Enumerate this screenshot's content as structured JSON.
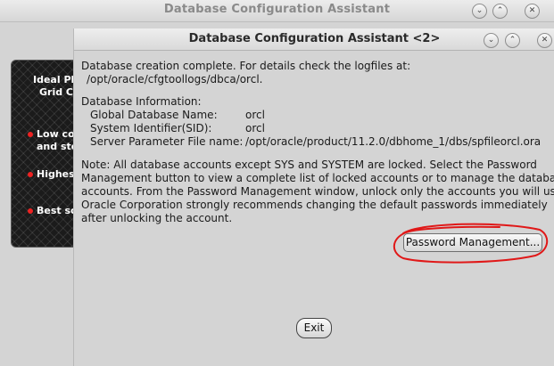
{
  "background_window": {
    "title": "Database Configuration Assistant",
    "panel_lines": [
      "Ideal Pl",
      "Grid C",
      "Low co",
      "and sto",
      "Highes",
      "Best sc"
    ]
  },
  "dialog": {
    "title": "Database Configuration Assistant <2>",
    "completion_line1": "Database creation complete. For details check the logfiles at:",
    "completion_line2": "/opt/oracle/cfgtoollogs/dbca/orcl.",
    "info_heading": "Database Information:",
    "info": [
      {
        "label": "Global Database Name:",
        "value": "orcl"
      },
      {
        "label": "System Identifier(SID):",
        "value": "orcl"
      },
      {
        "label": "Server Parameter File name:",
        "value": "/opt/oracle/product/11.2.0/dbhome_1/dbs/spfileorcl.ora"
      }
    ],
    "note_lines": [
      "Note: All database accounts except SYS and SYSTEM are locked. Select the Password",
      "Management button to view a complete list of locked accounts or to manage the database",
      "accounts. From the Password Management window, unlock only the accounts you will use.",
      "Oracle Corporation strongly recommends changing the default passwords immediately",
      "after unlocking the account."
    ],
    "password_button": "Password Management...",
    "exit_button": "Exit"
  },
  "colors": {
    "annotation": "#e01818",
    "panel_bullet": "#e22222"
  }
}
